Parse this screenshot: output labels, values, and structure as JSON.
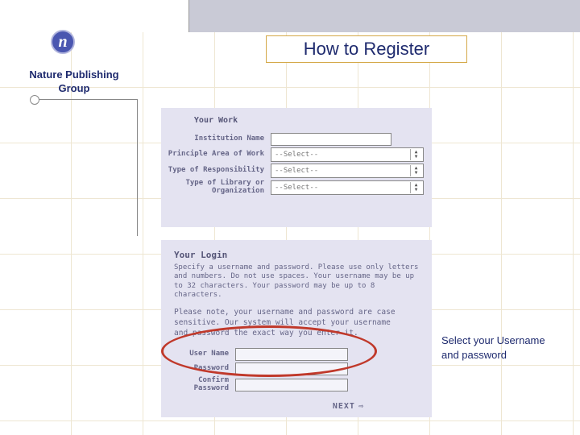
{
  "header": {
    "title": "How to Register"
  },
  "sidebar": {
    "org_name": "Nature Publishing Group",
    "logo_letter": "n"
  },
  "work_panel": {
    "title": "Your Work",
    "fields": {
      "institution_label": "Institution Name",
      "principle_label": "Principle Area of Work",
      "responsibility_label": "Type of Responsibility",
      "library_label": "Type of Library or Organization",
      "select_placeholder": "--Select--"
    }
  },
  "login_panel": {
    "title": "Your Login",
    "instructions": "Specify a username and password. Please use only letters and numbers. Do not use spaces. Your username may be up to 32 characters. Your password may be up to 8 characters.",
    "note": "Please note, your username and password are case sensitive. Our system will accept your username and password the exact way you enter it.",
    "fields": {
      "username_label": "User Name",
      "password_label": "Password",
      "confirm_label": "Confirm Password"
    },
    "next_label": "NEXT"
  },
  "callout": {
    "text": "Select your Username and password"
  },
  "colors": {
    "accent": "#1e2a6e",
    "panel_bg": "#e4e3f1",
    "title_border": "#d4a848",
    "annotation": "#c0392b"
  }
}
